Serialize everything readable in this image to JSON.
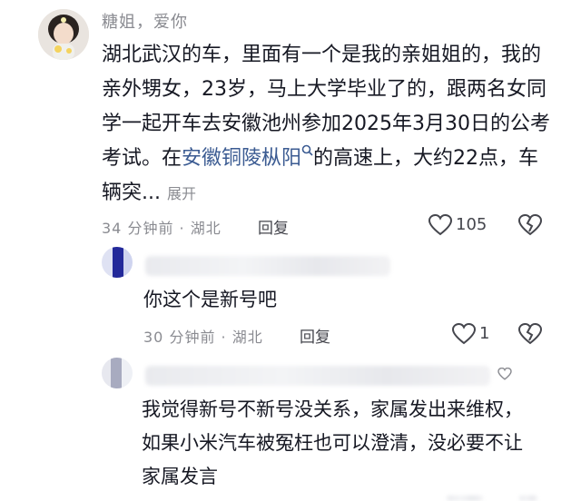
{
  "main_comment": {
    "username": "糖姐，爱你",
    "text_before_link": "湖北武汉的车，里面有一个是我的亲姐姐的，我的亲外甥女，23岁，马上大学毕业了的，跟两名女同学一起开车去安徽池州参加2025年3月30日的公考考试。在",
    "link": "安徽铜陵枞阳",
    "text_after_link": "的高速上，大约22点，车辆突...",
    "expand": "展开",
    "time_location": "34 分钟前 · 湖北",
    "reply_label": "回复",
    "like_count": "105"
  },
  "replies": [
    {
      "text": "你这个是新号吧",
      "time_location": "30 分钟前 · 湖北",
      "reply_label": "回复",
      "like_count": "1"
    },
    {
      "text": "我觉得新号不新号没关系，家属发出来维权，如果小米汽车被冤枉也可以澄清，没必要不让家属发言"
    }
  ],
  "icons": {
    "like": "heart-outline-icon",
    "dislike": "broken-heart-icon",
    "search_link": "search-icon",
    "small_heart": "heart-icon"
  },
  "colors": {
    "meta_gray": "#8a8b91",
    "link_blue": "#3b5b92",
    "text_dark": "#161823"
  }
}
